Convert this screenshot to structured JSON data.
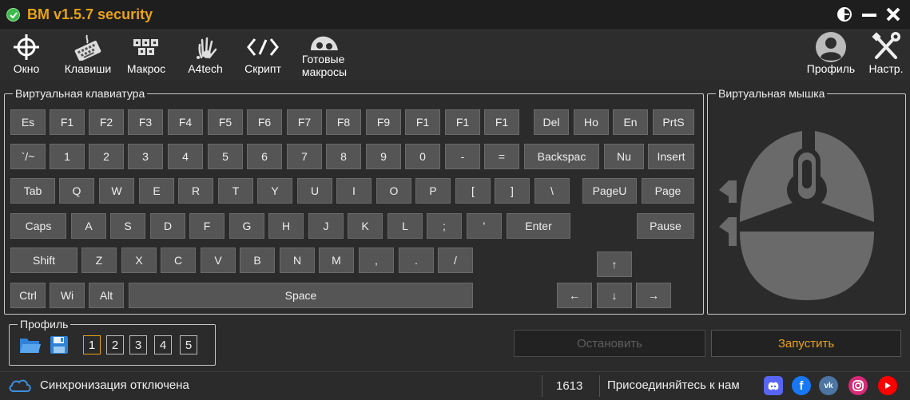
{
  "app": {
    "title": "BM v1.5.7 security"
  },
  "toolbar": {
    "items": [
      {
        "label": "Окно",
        "icon": "crosshair-icon"
      },
      {
        "label": "Клавиши",
        "icon": "keyboard-icon"
      },
      {
        "label": "Макрос",
        "icon": "macro-keys-icon"
      },
      {
        "label": "A4tech",
        "icon": "a4tech-logo-icon"
      },
      {
        "label": "Скрипт",
        "icon": "code-icon"
      },
      {
        "label": "Готовые\nмакросы",
        "icon": "ready-macros-icon"
      }
    ],
    "right": [
      {
        "label": "Профиль",
        "icon": "user-icon"
      },
      {
        "label": "Настр.",
        "icon": "tools-icon"
      }
    ]
  },
  "keyboard": {
    "title": "Виртуальная клавиатура",
    "rows": {
      "r1": [
        "Es",
        "F1",
        "F2",
        "F3",
        "F4",
        "F5",
        "F6",
        "F7",
        "F8",
        "F9",
        "F1",
        "F1",
        "F1",
        "Del",
        "Ho",
        "En",
        "PrtS"
      ],
      "r2": [
        "`/~",
        "1",
        "2",
        "3",
        "4",
        "5",
        "6",
        "7",
        "8",
        "9",
        "0",
        "-",
        "=",
        "Backspac",
        "Nu",
        "Insert"
      ],
      "r3": [
        "Tab",
        "Q",
        "W",
        "E",
        "R",
        "T",
        "Y",
        "U",
        "I",
        "O",
        "P",
        "[",
        "]",
        "\\",
        "PageU",
        "Page"
      ],
      "r4": [
        "Caps",
        "A",
        "S",
        "D",
        "F",
        "G",
        "H",
        "J",
        "K",
        "L",
        ";",
        "'",
        "Enter",
        "Pause"
      ],
      "r5": [
        "Shift",
        "Z",
        "X",
        "C",
        "V",
        "B",
        "N",
        "M",
        ",",
        ".",
        "/",
        "↑"
      ],
      "r6": [
        "Ctrl",
        "Wi",
        "Alt",
        "Space",
        "←",
        "↓",
        "→"
      ]
    }
  },
  "mouse": {
    "title": "Виртуальная мышка"
  },
  "profile": {
    "title": "Профиль",
    "numbers": [
      "1",
      "2",
      "3",
      "4",
      "5"
    ],
    "active": "1"
  },
  "actions": {
    "stop": "Остановить",
    "start": "Запустить"
  },
  "status": {
    "sync": "Синхронизация отключена",
    "count": "1613",
    "join": "Присоединяйтесь к нам"
  },
  "colors": {
    "accent": "#e8a317",
    "background": "#2b2b2b",
    "key": "#555555"
  }
}
